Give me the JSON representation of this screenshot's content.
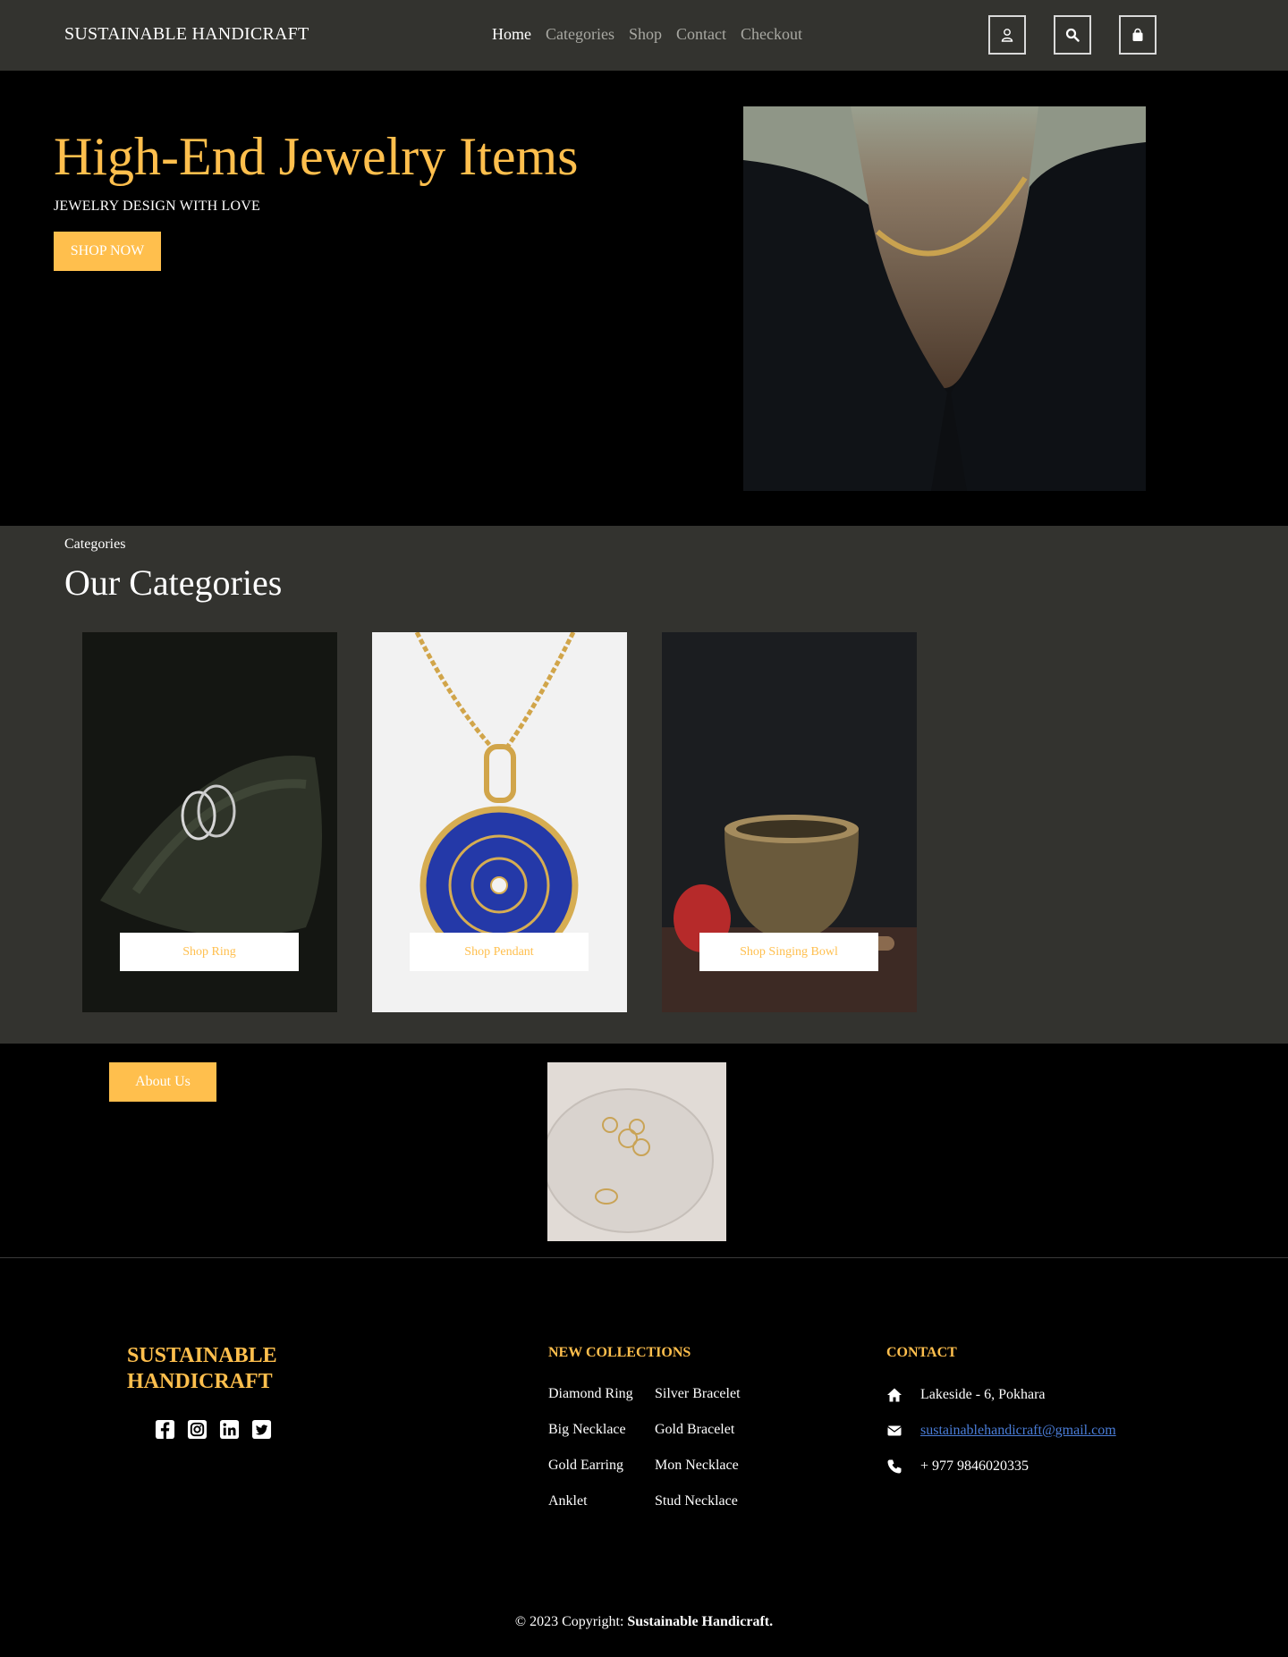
{
  "nav": {
    "brand": "SUSTAINABLE HANDICRAFT",
    "links": [
      "Home",
      "Categories",
      "Shop",
      "Contact",
      "Checkout"
    ],
    "icons": [
      "user-icon",
      "search-icon",
      "shopping-bag-icon"
    ]
  },
  "hero": {
    "title": "High-End Jewelry Items",
    "subtitle": "JEWELRY DESIGN WITH LOVE",
    "cta": "SHOP NOW"
  },
  "categories": {
    "eyebrow": "Categories",
    "title": "Our Categories",
    "cards": [
      {
        "button": "Shop Ring"
      },
      {
        "button": "Shop Pendant"
      },
      {
        "button": "Shop Singing Bowl"
      }
    ]
  },
  "about": {
    "button": "About Us"
  },
  "footer": {
    "brand_line1": "SUSTAINABLE",
    "brand_line2": "HANDICRAFT",
    "socials": [
      "facebook-icon",
      "instagram-icon",
      "linkedin-icon",
      "twitter-icon"
    ],
    "collections_heading": "NEW COLLECTIONS",
    "collections_col1": [
      "Diamond Ring",
      "Big Necklace",
      "Gold Earring",
      "Anklet"
    ],
    "collections_col2": [
      "Silver Bracelet",
      "Gold Bracelet",
      "Mon Necklace",
      "Stud Necklace"
    ],
    "contact_heading": "CONTACT",
    "address": "Lakeside - 6, Pokhara",
    "email": " sustainablehandicraft@gmail.com",
    "phone": "+ 977 9846020335",
    "copyright_prefix": "© 2023 Copyright: ",
    "copyright_name": "Sustainable Handicraft."
  },
  "colors": {
    "accent": "#ffbf4d",
    "nav_bg": "#33332f",
    "page_bg": "#000000",
    "link": "#4a7dd8"
  }
}
